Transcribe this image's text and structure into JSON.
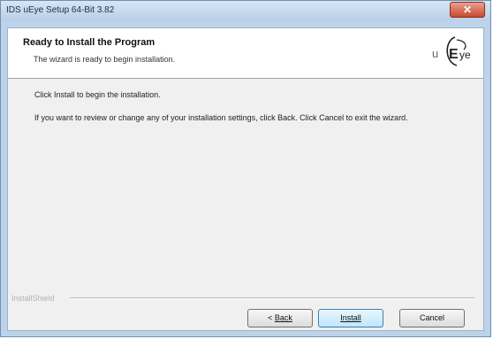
{
  "window": {
    "title": "IDS uEye Setup 64-Bit 3.82"
  },
  "header": {
    "title": "Ready to Install the Program",
    "subtitle": "The wizard is ready to begin installation.",
    "logo_text": "uEye"
  },
  "body": {
    "line1": "Click Install to begin the installation.",
    "line2": "If you want to review or change any of your installation settings, click Back. Click Cancel to exit the wizard."
  },
  "footer": {
    "brand": "InstallShield"
  },
  "buttons": {
    "back_prefix": "< ",
    "back_label": "Back",
    "install_label": "Install",
    "cancel_label": "Cancel"
  },
  "colors": {
    "close": "#c74b2f",
    "install_focus": "#3c7fb1"
  },
  "icons": {
    "close": "close-icon",
    "logo": "ueye-logo"
  }
}
